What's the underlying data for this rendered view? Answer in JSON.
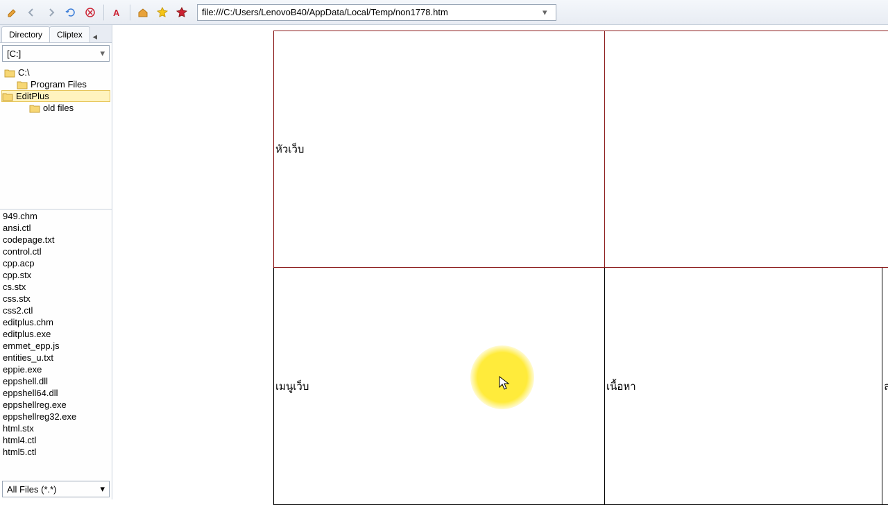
{
  "toolbar": {
    "url": "file:///C:/Users/LenovoB40/AppData/Local/Temp/non1778.htm"
  },
  "sidebar": {
    "tabs": [
      "Directory",
      "Cliptex"
    ],
    "active_tab": 0,
    "drive": "[C:]",
    "tree": [
      {
        "label": "C:\\",
        "indent": 0,
        "sel": false
      },
      {
        "label": "Program Files",
        "indent": 1,
        "sel": false
      },
      {
        "label": "EditPlus",
        "indent": 2,
        "sel": true
      },
      {
        "label": "old files",
        "indent": 2,
        "sel": false
      }
    ],
    "files": [
      "949.chm",
      "ansi.ctl",
      "codepage.txt",
      "control.ctl",
      "cpp.acp",
      "cpp.stx",
      "cs.stx",
      "css.stx",
      "css2.ctl",
      "editplus.chm",
      "editplus.exe",
      "emmet_epp.js",
      "entities_u.txt",
      "eppie.exe",
      "eppshell.dll",
      "eppshell64.dll",
      "eppshellreg.exe",
      "eppshellreg32.exe",
      "html.stx",
      "html4.ctl",
      "html5.ctl"
    ],
    "filter": "All Files (*.*)"
  },
  "page": {
    "cell_header": "หัวเว็บ",
    "cell_menu": "เมนูเว็บ",
    "cell_content": "เนื้อหา",
    "cell_right": "ล"
  }
}
